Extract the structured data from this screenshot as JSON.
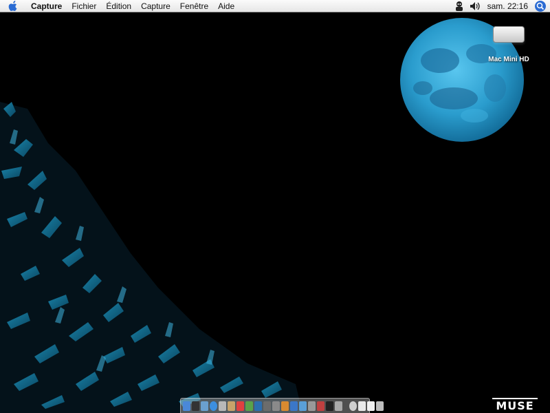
{
  "menubar": {
    "app_name": "Capture",
    "menus": [
      "Fichier",
      "Édition",
      "Capture",
      "Fenêtre",
      "Aide"
    ],
    "clock": "sam. 22:16",
    "icons": [
      "apple-icon",
      "user-icon",
      "volume-icon",
      "spotlight-icon"
    ]
  },
  "desktop": {
    "drive_label": "Mac Mini HD",
    "wallpaper_logo": "MUSE",
    "colors": {
      "background": "#000000",
      "moon": "#2fa3d6",
      "hands": "#1f8fb8"
    }
  },
  "dock": {
    "app_count": 18,
    "right_count": 4
  }
}
